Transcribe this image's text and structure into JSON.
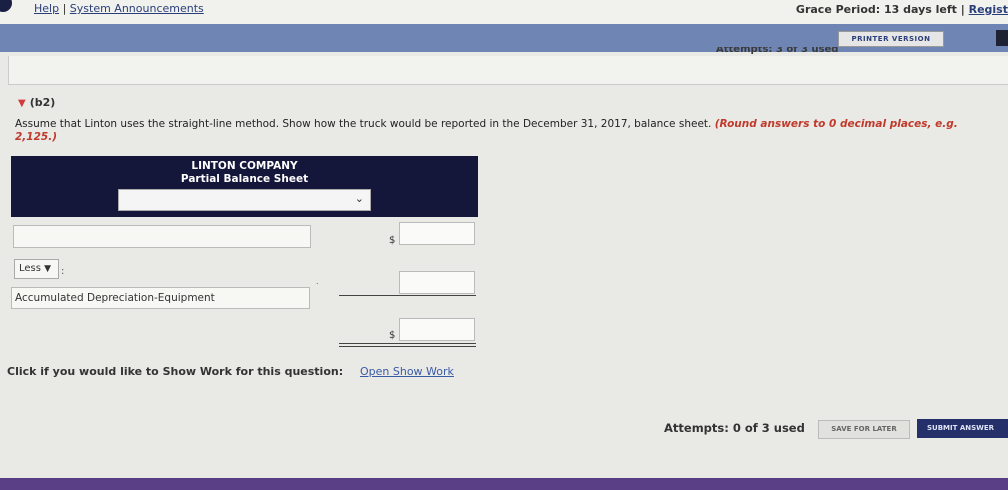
{
  "topbar": {
    "help_link": "Help",
    "separator": " | ",
    "announcements_link": "System Announcements",
    "grace_period": "Grace Period: 13 days left",
    "register_link": "Regist"
  },
  "toolbar": {
    "printer_version": "PRINTER VERSION",
    "attempts_previous": "Attempts: 3 of 3 used"
  },
  "question": {
    "part_label": "(b2)",
    "instructions": "Assume that Linton uses the straight-line method. Show how the truck would be reported in the December 31, 2017, balance sheet.",
    "rounding_note": "(Round answers to 0 decimal places, e.g. 2,125.)"
  },
  "balance_sheet": {
    "company": "LINTON COMPANY",
    "statement": "Partial Balance Sheet",
    "date_select_value": "",
    "item_input_value": "",
    "currency_symbol": "$",
    "less_select_value": "Less",
    "accumulated_label": "Accumulated Depreciation-Equipment",
    "amount_1": "",
    "amount_2": "",
    "amount_total": ""
  },
  "footer": {
    "show_work_prompt": "Click if you would like to Show Work for this question:",
    "show_work_link": "Open Show Work",
    "attempts": "Attempts: 0 of 3 used",
    "save_label": "SAVE FOR LATER",
    "submit_label": "SUBMIT ANSWER"
  },
  "colors": {
    "header_bg": "#14163a",
    "blue_bar": "#6f86b5",
    "red_note": "#c0392b",
    "submit_bg": "#25306a"
  }
}
